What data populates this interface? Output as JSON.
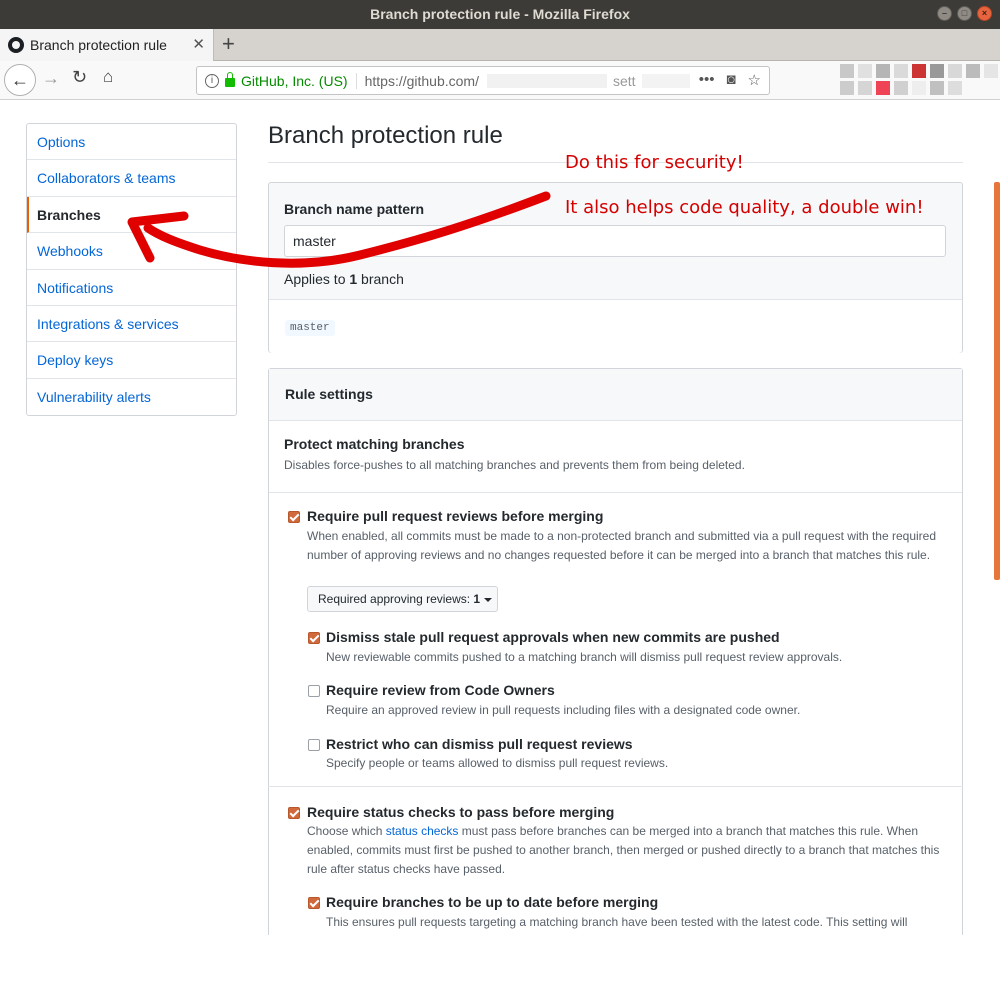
{
  "window": {
    "title": "Branch protection rule - Mozilla Firefox",
    "btn_minimize": "–",
    "btn_maximize": "□",
    "btn_close": "×"
  },
  "tab": {
    "label": "Branch protection rule",
    "close": "✕",
    "new_tab": "+"
  },
  "nav": {
    "back": "←",
    "forward": "→",
    "reload": "↻",
    "home": "⌂",
    "info": "i",
    "org": "GitHub, Inc. (US)",
    "url_visible": "https://github.com/",
    "url_tail": "sett",
    "menu_dots": "•••",
    "pocket": "◙",
    "bookmark": "☆"
  },
  "sidebar": {
    "items": [
      {
        "label": "Options",
        "active": false
      },
      {
        "label": "Collaborators & teams",
        "active": false
      },
      {
        "label": "Branches",
        "active": true
      },
      {
        "label": "Webhooks",
        "active": false
      },
      {
        "label": "Notifications",
        "active": false
      },
      {
        "label": "Integrations & services",
        "active": false
      },
      {
        "label": "Deploy keys",
        "active": false
      },
      {
        "label": "Vulnerability alerts",
        "active": false
      }
    ]
  },
  "main": {
    "title": "Branch protection rule",
    "pattern_label": "Branch name pattern",
    "pattern_value": "master",
    "applies_prefix": "Applies to ",
    "applies_count": "1",
    "applies_suffix": " branch",
    "matched_branch": "master",
    "rule_settings": "Rule settings",
    "protect_title": "Protect matching branches",
    "protect_desc": "Disables force-pushes to all matching branches and prevents them from being deleted.",
    "options": {
      "req_reviews": {
        "title": "Require pull request reviews before merging",
        "checked": true,
        "desc": "When enabled, all commits must be made to a non-protected branch and submitted via a pull request with the required number of approving reviews and no changes requested before it can be merged into a branch that matches this rule."
      },
      "approving_reviews": {
        "label": "Required approving reviews: ",
        "value": "1"
      },
      "dismiss_stale": {
        "title": "Dismiss stale pull request approvals when new commits are pushed",
        "checked": true,
        "desc": "New reviewable commits pushed to a matching branch will dismiss pull request review approvals."
      },
      "code_owners": {
        "title": "Require review from Code Owners",
        "checked": false,
        "desc": "Require an approved review in pull requests including files with a designated code owner."
      },
      "restrict_dismiss": {
        "title": "Restrict who can dismiss pull request reviews",
        "checked": false,
        "desc": "Specify people or teams allowed to dismiss pull request reviews."
      },
      "status_checks": {
        "title": "Require status checks to pass before merging",
        "checked": true,
        "desc_pre": "Choose which ",
        "desc_link": "status checks",
        "desc_post": " must pass before branches can be merged into a branch that matches this rule. When enabled, commits must first be pushed to another branch, then merged or pushed directly to a branch that matches this rule after status checks have passed."
      },
      "up_to_date": {
        "title": "Require branches to be up to date before merging",
        "checked": true,
        "desc": "This ensures pull requests targeting a matching branch have been tested with the latest code. This setting will"
      }
    }
  },
  "annotations": {
    "line1": "Do this for security!",
    "line2": "It also helps code quality, a double win!",
    "color": "#d40000"
  },
  "colors": {
    "accent": "#e36209",
    "checkbox": "#d0693b",
    "link": "#0366d6"
  }
}
